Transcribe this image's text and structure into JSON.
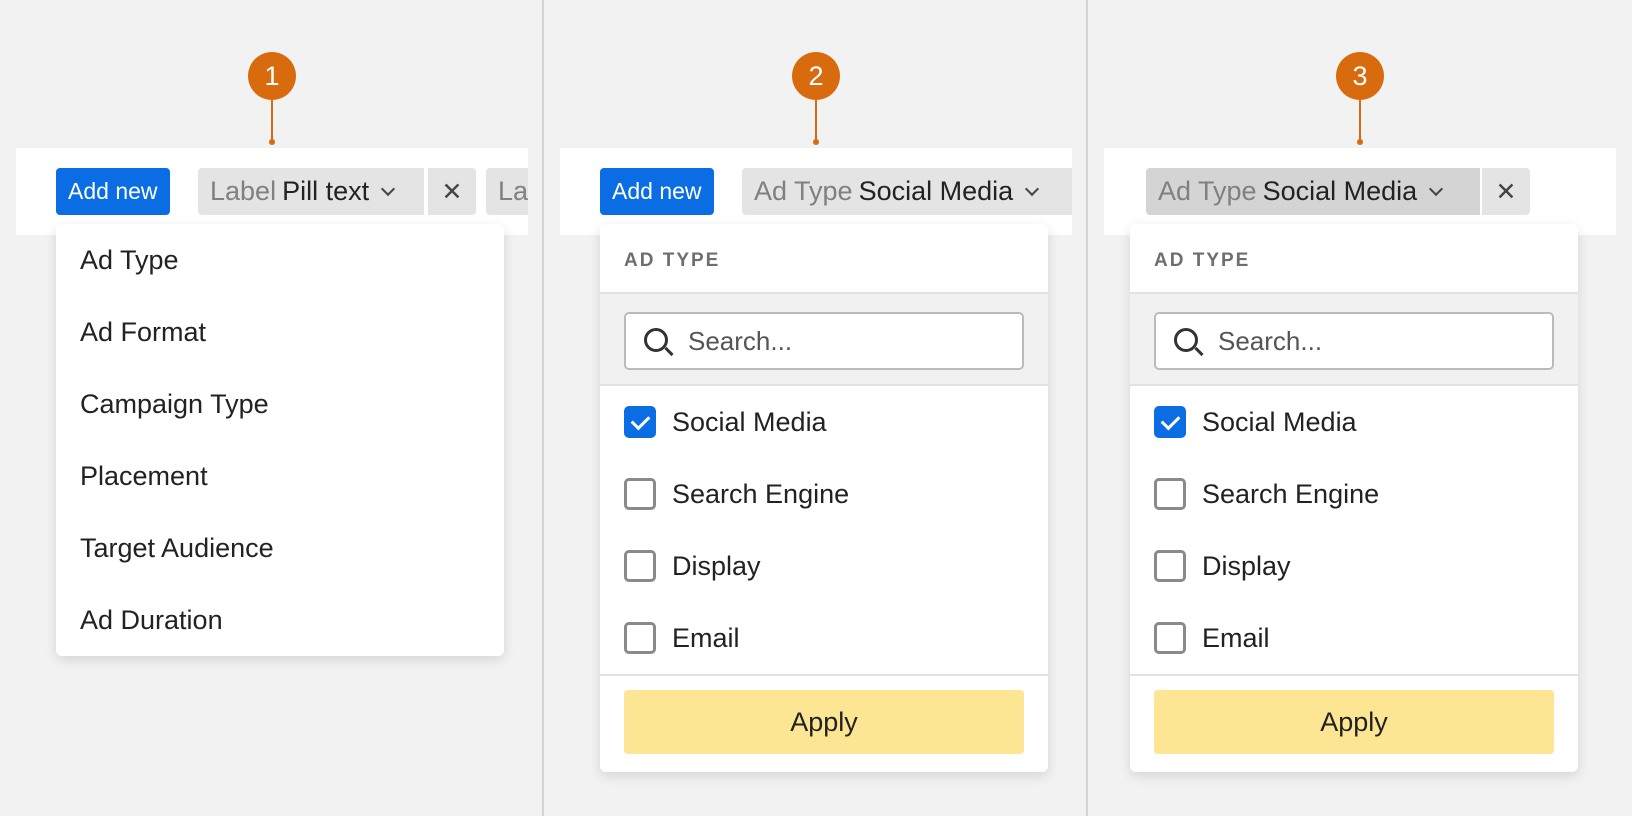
{
  "steps": [
    "1",
    "2",
    "3"
  ],
  "panel1": {
    "add_new_label": "Add new",
    "pill": {
      "label": "Label",
      "value": "Pill text"
    },
    "ghost_pill_text": "Label",
    "menu_items": [
      "Ad Type",
      "Ad Format",
      "Campaign Type",
      "Placement",
      "Target Audience",
      "Ad Duration"
    ]
  },
  "panel2": {
    "add_new_label": "Add new",
    "pill": {
      "label": "Ad Type",
      "value": "Social Media"
    },
    "dropdown": {
      "heading": "AD TYPE",
      "search_placeholder": "Search...",
      "options": [
        {
          "label": "Social Media",
          "checked": true
        },
        {
          "label": "Search Engine",
          "checked": false
        },
        {
          "label": "Display",
          "checked": false
        },
        {
          "label": "Email",
          "checked": false
        }
      ],
      "apply_label": "Apply"
    }
  },
  "panel3": {
    "pill": {
      "label": "Ad Type",
      "value": "Social Media"
    },
    "dropdown": {
      "heading": "AD TYPE",
      "search_placeholder": "Search...",
      "options": [
        {
          "label": "Social Media",
          "checked": true
        },
        {
          "label": "Search Engine",
          "checked": false
        },
        {
          "label": "Display",
          "checked": false
        },
        {
          "label": "Email",
          "checked": false
        }
      ],
      "apply_label": "Apply"
    }
  },
  "colors": {
    "accent": "#0a6de4",
    "marker": "#d76b0e",
    "apply": "#fce693"
  },
  "icons": [
    "chevron-down-icon",
    "close-icon",
    "search-icon",
    "checkmark-icon"
  ]
}
